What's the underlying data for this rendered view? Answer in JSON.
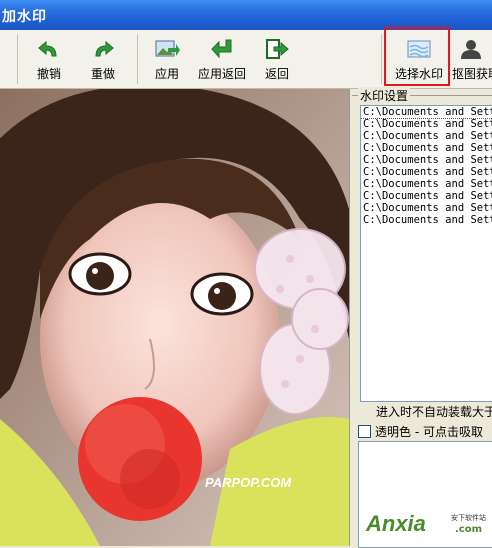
{
  "window": {
    "title": "加水印"
  },
  "toolbar": {
    "undo": "撤销",
    "redo": "重做",
    "apply": "应用",
    "apply_back": "应用返回",
    "back": "返回",
    "select_watermark": "选择水印",
    "capture": "抠图获取"
  },
  "panel": {
    "group_title": "水印设置",
    "files": [
      "C:\\Documents and Settings",
      "C:\\Documents and Settings",
      "C:\\Documents and Settings",
      "C:\\Documents and Settings",
      "C:\\Documents and Settings",
      "C:\\Documents and Settings",
      "C:\\Documents and Settings",
      "C:\\Documents and Settings",
      "C:\\Documents and Settings",
      "C:\\Documents and Settings"
    ],
    "autoload_note": "进入时不自动装载大于",
    "transparent_label": "透明色 - 可点击吸取"
  },
  "photo": {
    "watermark_text": "PARPOP.COM"
  },
  "brand": {
    "logo": "Anxia",
    "sub": "安下软件站",
    "domain": ".com"
  },
  "colors": {
    "title_bar": "#2a6fe0",
    "highlight": "#e3161d",
    "brand": "#4a8c2b"
  }
}
